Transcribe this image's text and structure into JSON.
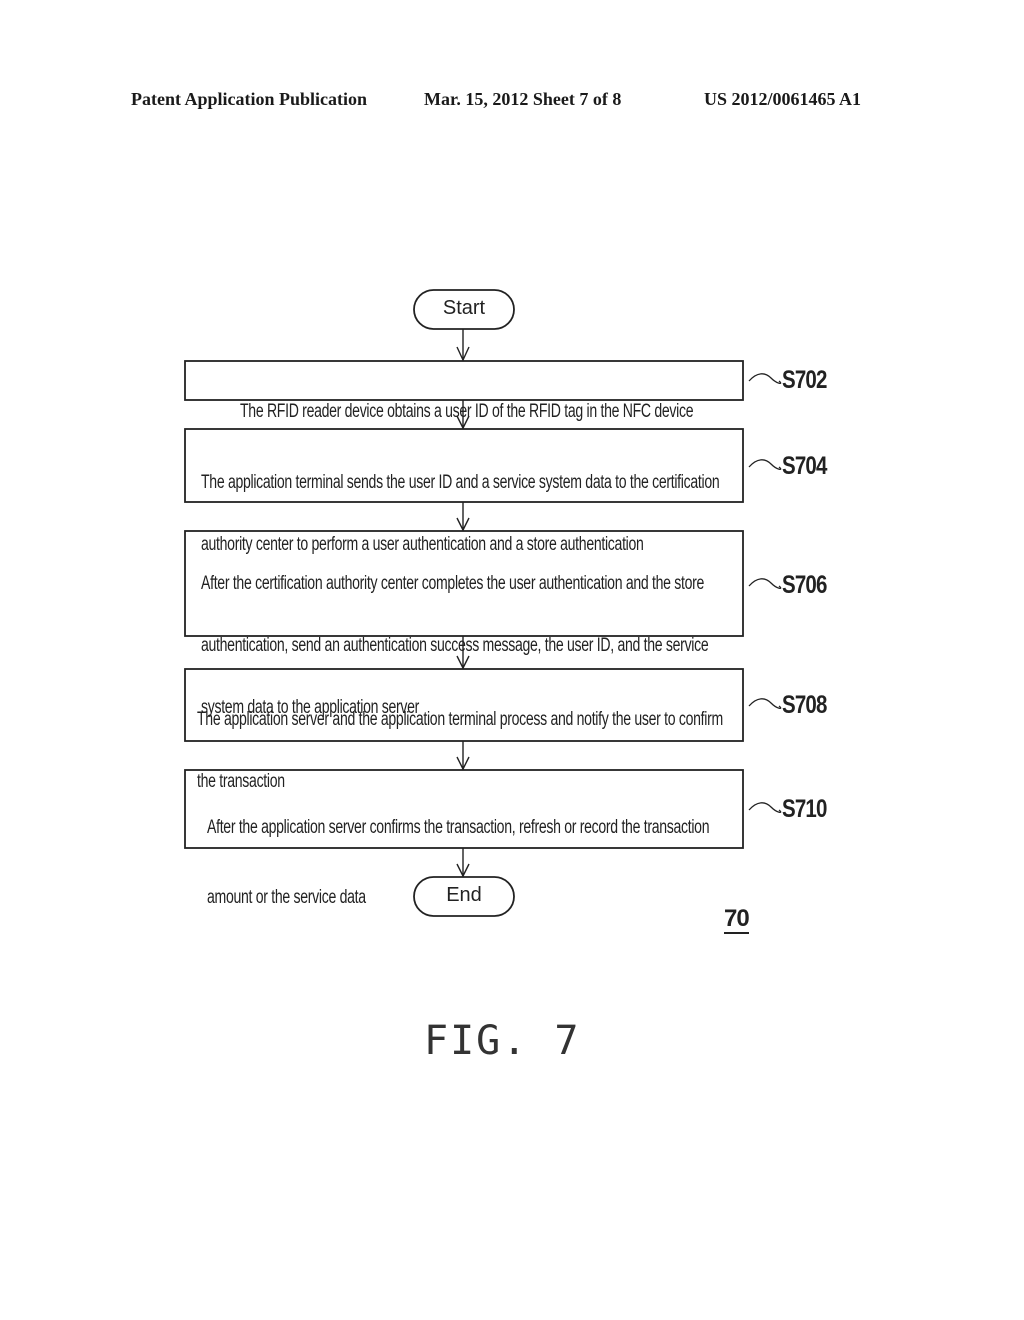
{
  "header": {
    "left": "Patent Application Publication",
    "middle": "Mar. 15, 2012  Sheet 7 of 8",
    "right": "US 2012/0061465 A1"
  },
  "flowchart": {
    "start_label": "Start",
    "end_label": "End",
    "steps": [
      {
        "id": "S702",
        "lines": [
          "The RFID reader device obtains a user ID of the RFID tag in the NFC device"
        ]
      },
      {
        "id": "S704",
        "lines": [
          "The application terminal sends the user ID and a service system data to the certification",
          "authority center to perform  a user authentication and a store authentication"
        ]
      },
      {
        "id": "S706",
        "lines": [
          "After the certification authority center  completes the user authentication and the store",
          "authentication, send an authentication success message, the user ID, and the service",
          "system data to the application server"
        ]
      },
      {
        "id": "S708",
        "lines": [
          "The application server and the application terminal process and notify the user to confirm",
          "the transaction"
        ]
      },
      {
        "id": "S710",
        "lines": [
          "After the application server confirms the transaction, refresh or record the transaction",
          "amount or the service data"
        ]
      }
    ],
    "reference_number": "70"
  },
  "figure_label": "FIG. 7"
}
